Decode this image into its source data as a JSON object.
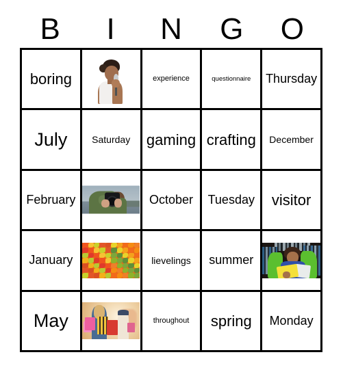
{
  "header": {
    "letters": [
      "B",
      "I",
      "N",
      "G",
      "O"
    ]
  },
  "grid": {
    "rows": [
      [
        {
          "type": "text",
          "text": "boring",
          "size": "lg"
        },
        {
          "type": "image",
          "image": "singer-photo",
          "alt": "woman singing into a microphone"
        },
        {
          "type": "text",
          "text": "experience",
          "size": "xs"
        },
        {
          "type": "text",
          "text": "questionnaire",
          "size": "xxs"
        },
        {
          "type": "text",
          "text": "Thursday",
          "size": "md"
        }
      ],
      [
        {
          "type": "text",
          "text": "July",
          "size": "xl"
        },
        {
          "type": "text",
          "text": "Saturday",
          "size": "sm"
        },
        {
          "type": "text",
          "text": "gaming",
          "size": "lg"
        },
        {
          "type": "text",
          "text": "crafting",
          "size": "lg"
        },
        {
          "type": "text",
          "text": "December",
          "size": "sm"
        }
      ],
      [
        {
          "type": "text",
          "text": "February",
          "size": "md"
        },
        {
          "type": "image",
          "image": "camera-photo",
          "alt": "person photographing with a camera by the sea"
        },
        {
          "type": "text",
          "text": "October",
          "size": "md"
        },
        {
          "type": "text",
          "text": "Tuesday",
          "size": "md"
        },
        {
          "type": "text",
          "text": "visitor",
          "size": "lg"
        }
      ],
      [
        {
          "type": "text",
          "text": "January",
          "size": "md"
        },
        {
          "type": "image",
          "image": "autumn-leaves-photo",
          "alt": "colorful autumn leaves"
        },
        {
          "type": "text",
          "text": "lievelings",
          "size": "sm"
        },
        {
          "type": "text",
          "text": "summer",
          "size": "md"
        },
        {
          "type": "image",
          "image": "library-photo",
          "alt": "boy reading a yellow book in a library"
        }
      ],
      [
        {
          "type": "text",
          "text": "May",
          "size": "xl"
        },
        {
          "type": "image",
          "image": "shopping-photo",
          "alt": "shopper carrying colorful shopping bags"
        },
        {
          "type": "text",
          "text": "throughout",
          "size": "xs"
        },
        {
          "type": "text",
          "text": "spring",
          "size": "lg"
        },
        {
          "type": "text",
          "text": "Monday",
          "size": "md"
        }
      ]
    ]
  },
  "colors": {
    "border": "#000000",
    "cell_background": "#ffffff",
    "text": "#000000"
  }
}
